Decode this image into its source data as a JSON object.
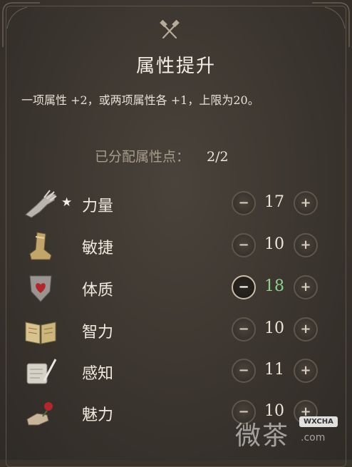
{
  "panel": {
    "title": "属性提升",
    "description": "一项属性 +2，或两项属性各 +1，上限为20。",
    "points_label": "已分配属性点：",
    "points_value": "2/2"
  },
  "attributes": [
    {
      "name": "力量",
      "value": "17",
      "starred": true,
      "icon": "gauntlet-icon"
    },
    {
      "name": "敏捷",
      "value": "10",
      "starred": false,
      "icon": "boot-icon"
    },
    {
      "name": "体质",
      "value": "18",
      "starred": false,
      "icon": "heart-shield-icon",
      "changed": true
    },
    {
      "name": "智力",
      "value": "10",
      "starred": false,
      "icon": "open-book-icon"
    },
    {
      "name": "感知",
      "value": "11",
      "starred": false,
      "icon": "scroll-quill-icon"
    },
    {
      "name": "魅力",
      "value": "10",
      "starred": false,
      "icon": "hand-rose-icon"
    }
  ],
  "controls": {
    "minus_symbol": "−",
    "plus_symbol": "+",
    "star_symbol": "★"
  },
  "watermark": {
    "text": "微茶",
    "badge": "WXCHA",
    "url": ".com"
  },
  "colors": {
    "changed_value": "#8fd18c",
    "background": "#3a342e"
  }
}
